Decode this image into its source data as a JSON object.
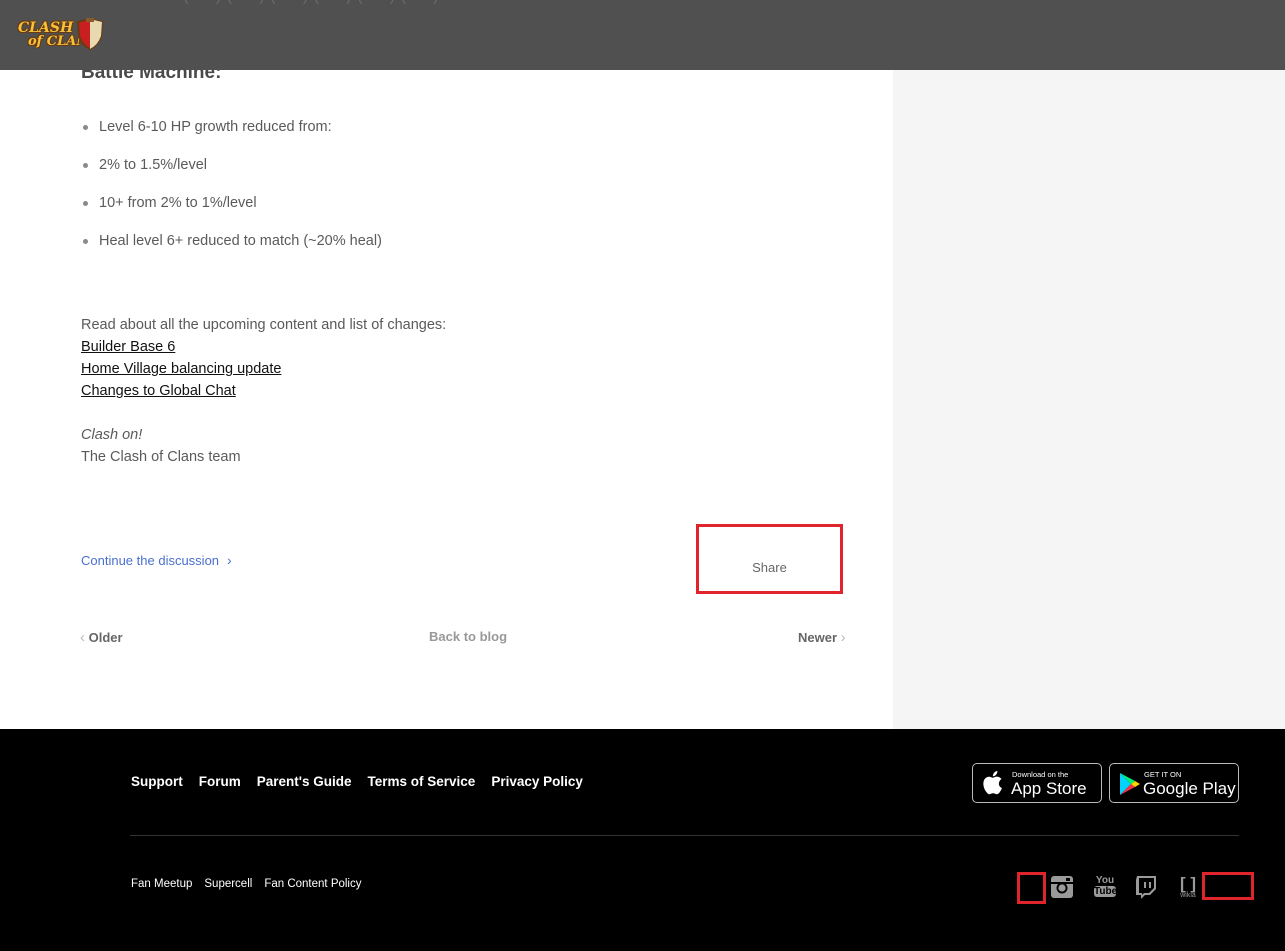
{
  "header": {
    "logo_text_line1": "CLASH",
    "logo_text_line2": "of CLANS",
    "ghost_text": "— — — ( — ) ( — ) ( — ) ( — ) ( — ) ( — )"
  },
  "article": {
    "heading": "Battle Machine:",
    "bullets": [
      "Level 6-10 HP growth reduced from:",
      "2% to 1.5%/level",
      "10+ from 2% to 1%/level",
      "Heal level 6+ reduced to match (~20% heal)"
    ],
    "read_about": "Read about all the upcoming content and list of changes:",
    "links": [
      "Builder Base 6",
      "Home Village balancing update ",
      "Changes to Global Chat"
    ],
    "sign_italic": "Clash on!",
    "sign_team": "The Clash of Clans team",
    "discussion": "Continue the discussion",
    "share": "Share"
  },
  "nav": {
    "older": "Older",
    "back": "Back to blog",
    "newer": "Newer"
  },
  "footer": {
    "links": [
      "Support",
      "Forum",
      "Parent's Guide",
      "Terms of Service",
      "Privacy Policy"
    ],
    "small_links": [
      "Fan Meetup",
      "Supercell",
      "Fan Content Policy"
    ],
    "app_store_small": "Download on the",
    "app_store_big": "App Store",
    "google_small": "GET IT ON",
    "google_big": "Google Play",
    "social": [
      "facebook-icon",
      "instagram-icon",
      "youtube-icon",
      "twitch-icon",
      "wikia-icon",
      "twitter-icon"
    ],
    "youtube_label_1": "You",
    "youtube_label_2": "Tube",
    "wikia_label": "wikia"
  },
  "colors": {
    "highlight": "#e0242b",
    "link_blue": "#4a6fd1",
    "header_bg": "#505050"
  }
}
